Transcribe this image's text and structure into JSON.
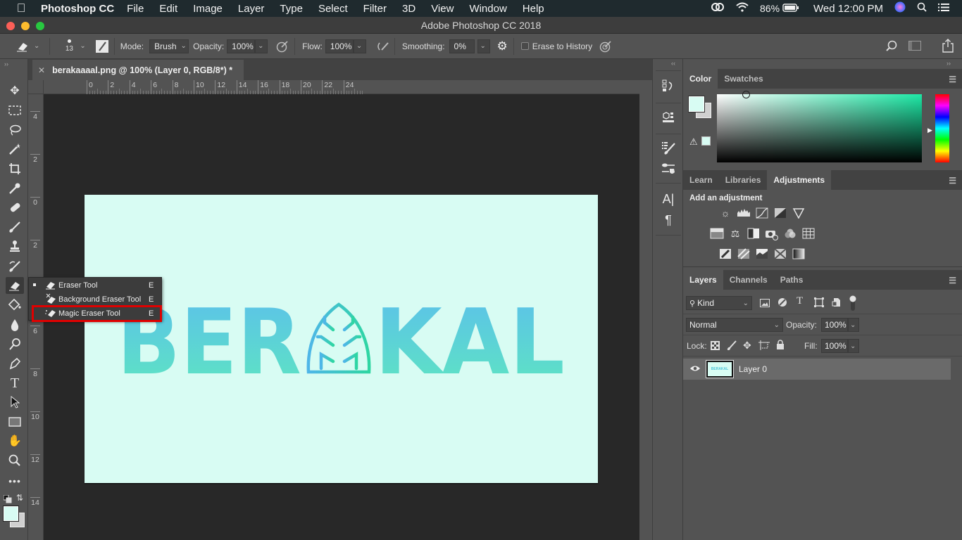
{
  "menubar": {
    "app_name": "Photoshop CC",
    "items": [
      "File",
      "Edit",
      "Image",
      "Layer",
      "Type",
      "Select",
      "Filter",
      "3D",
      "View",
      "Window",
      "Help"
    ],
    "battery": "86%",
    "clock": "Wed 12:00 PM",
    "icons": [
      "apple-icon",
      "creative-cloud-icon",
      "wifi-icon",
      "battery-icon",
      "siri-icon",
      "spotlight-search-icon",
      "notification-center-icon"
    ]
  },
  "window": {
    "title": "Adobe Photoshop CC 2018"
  },
  "options_bar": {
    "brush_size": "13",
    "mode_label": "Mode:",
    "mode_value": "Brush",
    "opacity_label": "Opacity:",
    "opacity_value": "100%",
    "flow_label": "Flow:",
    "flow_value": "100%",
    "smoothing_label": "Smoothing:",
    "smoothing_value": "0%",
    "erase_to_history_label": "Erase to History",
    "erase_to_history_checked": false
  },
  "document": {
    "tab_title": "berakaaaal.png @ 100% (Layer 0, RGB/8*) *",
    "image_text": "BERAKAL",
    "image_background": "#d8fcf3",
    "h_ruler_labels": [
      "0",
      "2",
      "4",
      "6",
      "8",
      "10",
      "12",
      "14",
      "16",
      "18",
      "20",
      "22",
      "24"
    ],
    "v_ruler_labels": [
      "4",
      "2",
      "0",
      "2",
      "6",
      "8",
      "10",
      "12",
      "14"
    ]
  },
  "tool_flyout": {
    "items": [
      {
        "label": "Eraser Tool",
        "shortcut": "E",
        "current": true
      },
      {
        "label": "Background Eraser Tool",
        "shortcut": "E",
        "current": false
      },
      {
        "label": "Magic Eraser Tool",
        "shortcut": "E",
        "current": false,
        "highlighted": true
      }
    ]
  },
  "color_panel": {
    "tabs": [
      "Color",
      "Swatches"
    ],
    "active_tab": "Color",
    "foreground_color": "#d8fcf3",
    "background_color": "#d0d0d0",
    "hue_color": "#1de9a6"
  },
  "adjustments_panel": {
    "tabs": [
      "Learn",
      "Libraries",
      "Adjustments"
    ],
    "active_tab": "Adjustments",
    "heading": "Add an adjustment"
  },
  "layers_panel": {
    "tabs": [
      "Layers",
      "Channels",
      "Paths"
    ],
    "active_tab": "Layers",
    "filter_kind": "Kind",
    "blend_mode": "Normal",
    "opacity_label": "Opacity:",
    "opacity_value": "100%",
    "lock_label": "Lock:",
    "fill_label": "Fill:",
    "fill_value": "100%",
    "layers": [
      {
        "name": "Layer 0",
        "visible": true,
        "selected": true
      }
    ]
  },
  "colors": {
    "accent_red": "#e00000",
    "logo_blue": "#5bc0eb",
    "logo_green": "#5ee6c0"
  }
}
